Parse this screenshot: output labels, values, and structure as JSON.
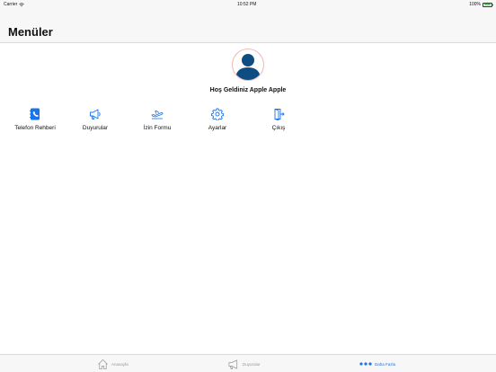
{
  "status": {
    "carrier": "Carrier",
    "time": "10:52 PM",
    "battery": "100%",
    "battery_level": 1.0
  },
  "header": {
    "title": "Menüler"
  },
  "profile": {
    "welcome": "Hoş Geldiniz Apple Apple"
  },
  "menu": {
    "items": [
      {
        "label": "Telefon Rehberi",
        "icon": "phonebook-icon"
      },
      {
        "label": "Duyurular",
        "icon": "megaphone-icon"
      },
      {
        "label": "İzin Formu",
        "icon": "airplane-icon"
      },
      {
        "label": "Ayarlar",
        "icon": "gear-icon"
      },
      {
        "label": "Çıkış",
        "icon": "exit-icon"
      }
    ]
  },
  "tabs": [
    {
      "label": "Anasayfa",
      "icon": "home-icon"
    },
    {
      "label": "Duyurular",
      "icon": "megaphone-icon"
    },
    {
      "label": "Daha Fazla",
      "icon": "more-icon",
      "active": true
    }
  ],
  "colors": {
    "accent": "#1a73e8",
    "avatar": "#0f4c81",
    "inactive": "#999999"
  }
}
